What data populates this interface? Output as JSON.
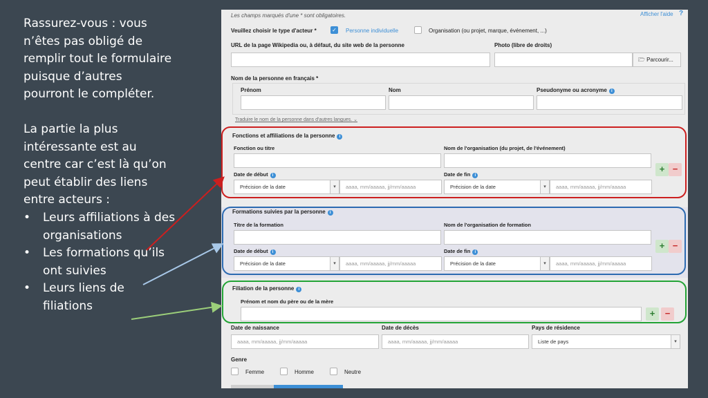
{
  "slide": {
    "para1": "Rassurez-vous : vous n’êtes pas obligé de remplir tout le formulaire puisque d’autres pourront le compléter.",
    "para2": "La partie la plus intéressante est au centre car c’est là qu’on peut établir des liens entre acteurs :",
    "bullets": [
      "Leurs affiliations à des organisations",
      "Les formations qu’ils ont suivies",
      "Leurs liens de filiations"
    ]
  },
  "form": {
    "required_note": "Les champs marqués d'une * sont obligatoires.",
    "help_link": "Afficher l'aide",
    "help_icon": "question-icon",
    "actor_type": {
      "label": "Veuillez choisir le type d'acteur *",
      "option1": "Personne individuelle",
      "option1_checked": true,
      "option2": "Organisation (ou projet, marque, événement, ...)",
      "option2_checked": false
    },
    "url_label": "URL de la page Wikipedia ou, à défaut, du site web de la personne",
    "photo_label": "Photo (libre de droits)",
    "browse_button": "Parcourir...",
    "name_section": {
      "label": "Nom de la personne en français *",
      "prenom": "Prénom",
      "nom": "Nom",
      "pseudonyme": "Pseudonyme ou acronyme"
    },
    "translate_link": "Traduire le nom de la personne dans d'autres langues.",
    "affiliations": {
      "title": "Fonctions et affiliations de la personne",
      "fonction": "Fonction ou titre",
      "organisation": "Nom de l'organisation (du projet, de l'événement)",
      "date_debut": "Date de début",
      "date_fin": "Date de fin",
      "precision": "Précision de la date",
      "date_placeholder": "aaaa, mm/aaaaa, jj/mm/aaaaa"
    },
    "formations": {
      "title": "Formations suivies par la personne",
      "titre": "Titre de la formation",
      "organisation": "Nom de l'organisation de formation",
      "date_debut": "Date de début",
      "date_fin": "Date de fin",
      "precision": "Précision de la date",
      "date_placeholder": "aaaa, mm/aaaaa, jj/mm/aaaaa"
    },
    "filiation": {
      "title": "Filiation de la personne",
      "parent_label": "Prénom et nom du père ou de la mère"
    },
    "birth": {
      "naissance": "Date de naissance",
      "deces": "Date de décès",
      "pays": "Pays de résidence",
      "date_placeholder": "aaaa, mm/aaaaa, jj/mm/aaaaa",
      "pays_value": "Liste de pays"
    },
    "genre": {
      "label": "Genre",
      "femme": "Femme",
      "homme": "Homme",
      "neutre": "Neutre"
    },
    "add_symbol": "+",
    "remove_symbol": "−"
  },
  "colors": {
    "slide_bg": "#3c4751",
    "red_frame": "#cc1f1f",
    "blue_frame": "#2c6ab1",
    "green_frame": "#22a335",
    "accent": "#3d8fd6"
  }
}
